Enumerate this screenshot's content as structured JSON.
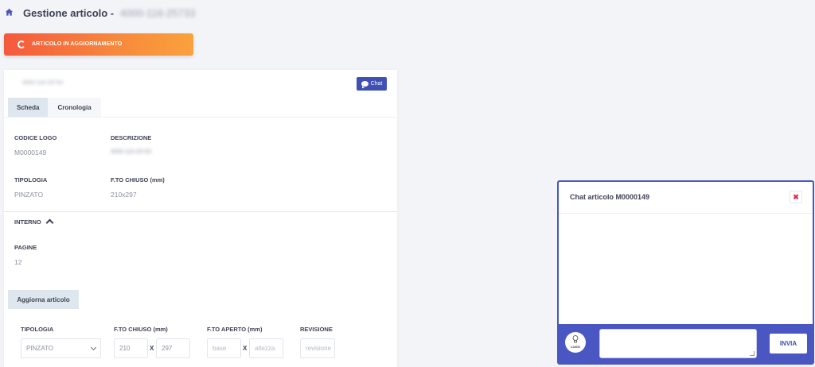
{
  "header": {
    "title": "Gestione articolo -",
    "article_code": "4000-116-25733"
  },
  "status_banner": {
    "text": "ARTICOLO IN AGGIORNAMENTO"
  },
  "card": {
    "code": "4000-116-25733",
    "chat_button_label": "Chat",
    "tabs": [
      {
        "label": "Scheda",
        "active": true
      },
      {
        "label": "Cronologia",
        "active": false
      }
    ],
    "fields": {
      "codice_logo": {
        "label": "CODICE LOGO",
        "value": "M0000149"
      },
      "descrizione": {
        "label": "DESCRIZIONE",
        "value": "4000-116-25733"
      },
      "tipologia": {
        "label": "TIPOLOGIA",
        "value": "PINZATO"
      },
      "fto_chiuso": {
        "label": "F.TO CHIUSO (mm)",
        "value": "210x297"
      }
    },
    "interno": {
      "label": "INTERNO",
      "pagine": {
        "label": "PAGINE",
        "value": "12"
      }
    },
    "update_button_label": "Aggiorna articolo",
    "form": {
      "tipologia": {
        "label": "TIPOLOGIA",
        "selected": "PINZATO"
      },
      "fto_chiuso": {
        "label": "F.TO CHIUSO (mm)",
        "width_value": "210",
        "sep": "X",
        "height_value": "297"
      },
      "fto_aperto": {
        "label": "F.TO APERTO (mm)",
        "base_placeholder": "base",
        "sep": "X",
        "altezza_placeholder": "altezza"
      },
      "revisione": {
        "label": "REVISIONE",
        "placeholder": "revisione"
      }
    }
  },
  "chat_panel": {
    "title": "Chat articolo M0000149",
    "close_symbol": "✖",
    "avatar_text": "LOGO",
    "send_label": "INVIA"
  },
  "colors": {
    "accent": "#3f51b5",
    "chat_border": "#4a57c2",
    "banner_start": "#f5593d",
    "banner_end": "#f9a23d",
    "close_red": "#e0284f"
  }
}
